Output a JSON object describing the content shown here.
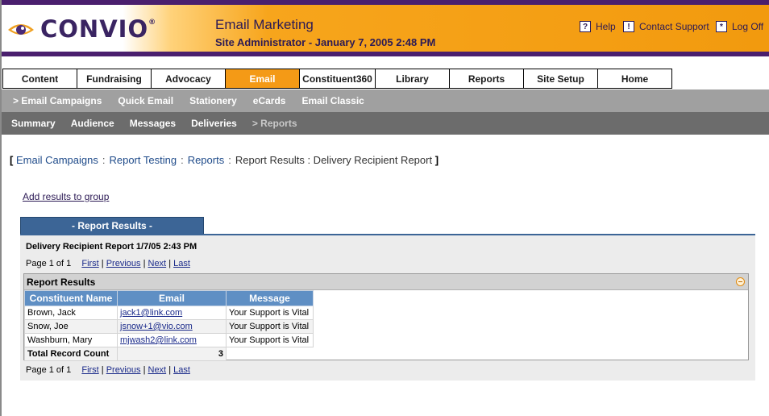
{
  "header": {
    "logo_text": "CONVIO",
    "app_title": "Email Marketing",
    "subtitle": "Site Administrator  -  January 7, 2005 2:48 PM",
    "utility": [
      {
        "icon": "?",
        "label": "Help"
      },
      {
        "icon": "!",
        "label": "Contact Support"
      },
      {
        "icon": "*",
        "label": "Log Off"
      }
    ]
  },
  "main_nav": [
    "Content",
    "Fundraising",
    "Advocacy",
    "Email",
    "Constituent360",
    "Library",
    "Reports",
    "Site Setup",
    "Home"
  ],
  "main_nav_active": "Email",
  "sub_nav_1": [
    "> Email Campaigns",
    "Quick Email",
    "Stationery",
    "eCards",
    "Email Classic"
  ],
  "sub_nav_2": [
    "Summary",
    "Audience",
    "Messages",
    "Deliveries",
    "> Reports"
  ],
  "breadcrumb": {
    "open": "[",
    "items": [
      "Email Campaigns",
      "Report Testing",
      "Reports"
    ],
    "current": "Report Results",
    "final": ": Delivery Recipient Report",
    "close": "]"
  },
  "add_results_link": "Add results to group",
  "report_tab": "- Report Results -",
  "report_title": "Delivery Recipient Report 1/7/05 2:43 PM",
  "pager": {
    "text": "Page 1 of 1",
    "first": "First",
    "previous": "Previous",
    "next": "Next",
    "last": "Last",
    "sep": "|"
  },
  "results": {
    "title": "Report Results",
    "columns": [
      "Constituent Name",
      "Email",
      "Message"
    ],
    "rows": [
      [
        "Brown, Jack",
        "jack1@link.com",
        "Your Support is Vital"
      ],
      [
        "Snow, Joe",
        "jsnow+1@vio.com",
        "Your Support is Vital"
      ],
      [
        "Washburn, Mary",
        "mjwash2@link.com",
        "Your Support is Vital"
      ]
    ],
    "total_label": "Total Record Count",
    "total_value": "3"
  },
  "colors": {
    "purple": "#4a1f6e",
    "orange": "#f49a16",
    "blue": "#3c6596"
  }
}
